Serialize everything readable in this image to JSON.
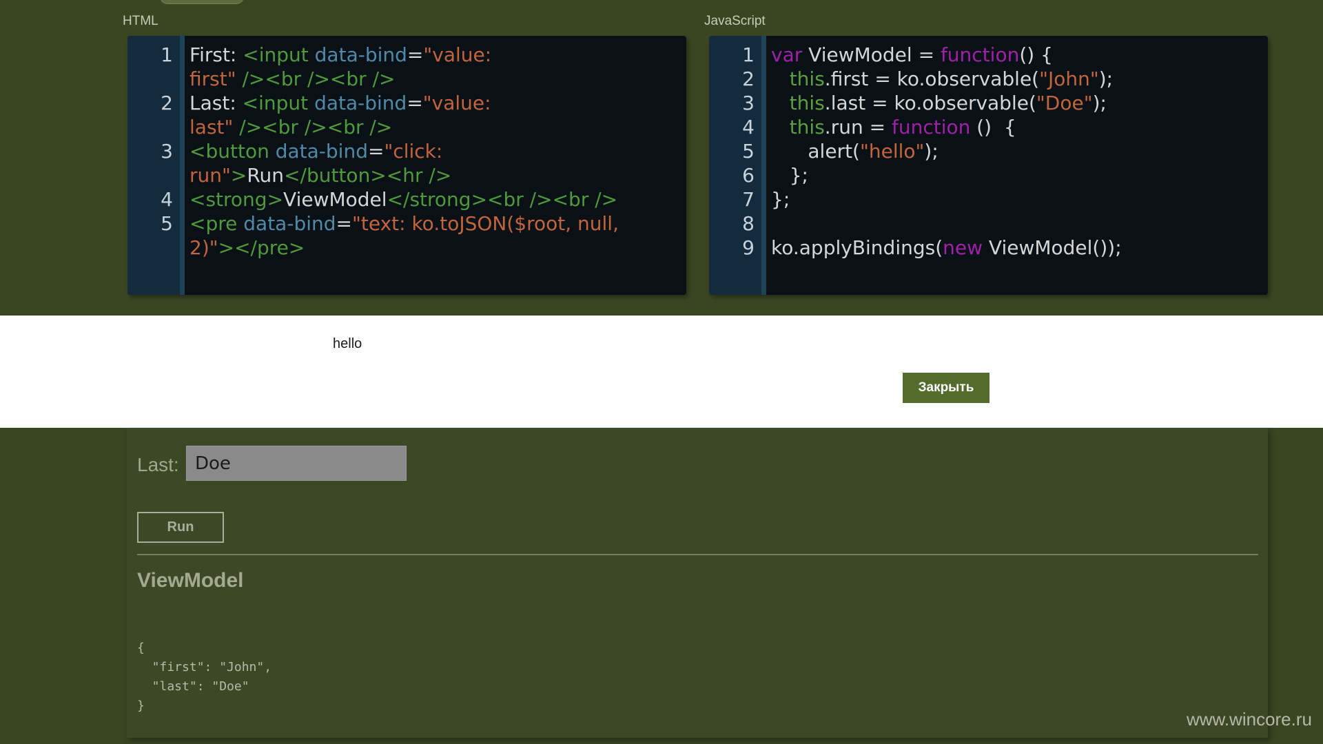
{
  "labels": {
    "html": "HTML",
    "javascript": "JavaScript"
  },
  "html_editor": {
    "lines": [
      {
        "num": "1",
        "parts": [
          {
            "c": "pln",
            "t": "First: "
          },
          {
            "c": "tag",
            "t": "<input "
          },
          {
            "c": "attr",
            "t": "data-bind"
          },
          {
            "c": "pln",
            "t": "="
          },
          {
            "c": "str",
            "t": "\"value:"
          }
        ]
      },
      {
        "num": "",
        "parts": [
          {
            "c": "str",
            "t": "first\""
          },
          {
            "c": "tag",
            "t": " /><br /><br />"
          }
        ]
      },
      {
        "num": "2",
        "parts": [
          {
            "c": "pln",
            "t": "Last: "
          },
          {
            "c": "tag",
            "t": "<input "
          },
          {
            "c": "attr",
            "t": "data-bind"
          },
          {
            "c": "pln",
            "t": "="
          },
          {
            "c": "str",
            "t": "\"value:"
          }
        ]
      },
      {
        "num": "",
        "parts": [
          {
            "c": "str",
            "t": "last\""
          },
          {
            "c": "tag",
            "t": " /><br /><br />"
          }
        ]
      },
      {
        "num": "3",
        "parts": [
          {
            "c": "tag",
            "t": "<button "
          },
          {
            "c": "attr",
            "t": "data-bind"
          },
          {
            "c": "pln",
            "t": "="
          },
          {
            "c": "str",
            "t": "\"click:"
          }
        ]
      },
      {
        "num": "",
        "parts": [
          {
            "c": "str",
            "t": "run\""
          },
          {
            "c": "tag",
            "t": ">"
          },
          {
            "c": "pln",
            "t": "Run"
          },
          {
            "c": "tag",
            "t": "</button><hr />"
          }
        ]
      },
      {
        "num": "4",
        "parts": [
          {
            "c": "tag",
            "t": "<strong>"
          },
          {
            "c": "pln",
            "t": "ViewModel"
          },
          {
            "c": "tag",
            "t": "</strong><br /><br />"
          }
        ]
      },
      {
        "num": "5",
        "parts": [
          {
            "c": "tag",
            "t": "<pre "
          },
          {
            "c": "attr",
            "t": "data-bind"
          },
          {
            "c": "pln",
            "t": "="
          },
          {
            "c": "str",
            "t": "\"text: ko.toJSON($root, null,"
          }
        ]
      },
      {
        "num": "",
        "parts": [
          {
            "c": "str",
            "t": "2)\""
          },
          {
            "c": "tag",
            "t": "></pre>"
          }
        ]
      }
    ]
  },
  "js_editor": {
    "lines": [
      {
        "num": "1",
        "parts": [
          {
            "c": "kw",
            "t": "var"
          },
          {
            "c": "pln",
            "t": " ViewModel = "
          },
          {
            "c": "kw",
            "t": "function"
          },
          {
            "c": "pln",
            "t": "() {"
          }
        ]
      },
      {
        "num": "2",
        "parts": [
          {
            "c": "pln",
            "t": "   "
          },
          {
            "c": "ths",
            "t": "this"
          },
          {
            "c": "pln",
            "t": ".first = ko.observable("
          },
          {
            "c": "str",
            "t": "\"John\""
          },
          {
            "c": "pln",
            "t": ");"
          }
        ]
      },
      {
        "num": "3",
        "parts": [
          {
            "c": "pln",
            "t": "   "
          },
          {
            "c": "ths",
            "t": "this"
          },
          {
            "c": "pln",
            "t": ".last = ko.observable("
          },
          {
            "c": "str",
            "t": "\"Doe\""
          },
          {
            "c": "pln",
            "t": ");"
          }
        ]
      },
      {
        "num": "4",
        "parts": [
          {
            "c": "pln",
            "t": "   "
          },
          {
            "c": "ths",
            "t": "this"
          },
          {
            "c": "pln",
            "t": ".run = "
          },
          {
            "c": "kw",
            "t": "function"
          },
          {
            "c": "pln",
            "t": " ()  {"
          }
        ]
      },
      {
        "num": "5",
        "parts": [
          {
            "c": "pln",
            "t": "      alert("
          },
          {
            "c": "str",
            "t": "\"hello\""
          },
          {
            "c": "pln",
            "t": ");"
          }
        ]
      },
      {
        "num": "6",
        "parts": [
          {
            "c": "pln",
            "t": "   };"
          }
        ]
      },
      {
        "num": "7",
        "parts": [
          {
            "c": "pln",
            "t": "};"
          }
        ]
      },
      {
        "num": "8",
        "parts": [
          {
            "c": "pln",
            "t": ""
          }
        ]
      },
      {
        "num": "9",
        "parts": [
          {
            "c": "pln",
            "t": "ko.applyBindings("
          },
          {
            "c": "kw",
            "t": "new"
          },
          {
            "c": "pln",
            "t": " ViewModel());"
          }
        ]
      }
    ]
  },
  "alert": {
    "message": "hello",
    "close_label": "Закрыть"
  },
  "result": {
    "last_label": "Last:",
    "last_value": "Doe",
    "run_label": "Run",
    "viewmodel_title": "ViewModel",
    "json_text": "{\n  \"first\": \"John\",\n  \"last\": \"Doe\"\n}"
  },
  "watermark": "www.wincore.ru",
  "colors": {
    "background": "#3a4522",
    "editor_bg": "#091117",
    "gutter_bg": "#132b3c",
    "dialog_button": "#536b2c"
  }
}
